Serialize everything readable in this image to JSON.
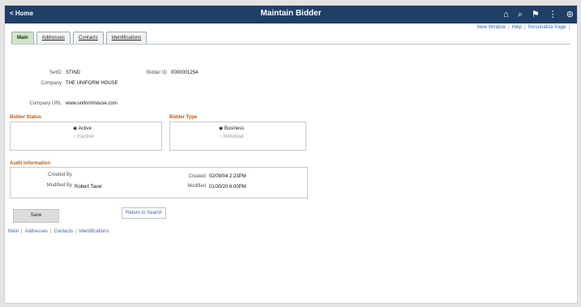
{
  "header": {
    "home": "< Home",
    "title": "Maintain Bidder",
    "icons": {
      "home": "⌂",
      "search": "⌕",
      "flag": "⚑",
      "menu": "⋮",
      "nav": "⊚"
    }
  },
  "toplinks": [
    "New Window",
    "Help",
    "Personalize Page"
  ],
  "tabs": [
    "Main",
    "Addresses",
    "Contacts",
    "Identifications"
  ],
  "fields": {
    "setid_label": "SetID",
    "setid_value": "STIND",
    "bidder_label": "Bidder ID",
    "bidder_value": "0000001254",
    "company_label": "Company",
    "company_value": "THE UNIFORM HOUSE",
    "url_label": "Company URL",
    "url_value": "www.uniformhouse.com"
  },
  "bidder_status": {
    "title": "Bidder Status",
    "options": [
      "Active",
      "Inactive"
    ],
    "selected": "Active"
  },
  "bidder_type": {
    "title": "Bidder Type",
    "options": [
      "Business",
      "Individual"
    ],
    "selected": "Business"
  },
  "audit": {
    "title": "Audit Information",
    "created_by_label": "Created By",
    "created_by_value": "",
    "modified_by_label": "Modified By",
    "modified_by_value": "Robert Tavel",
    "created_label": "Created",
    "created_value": "02/09/04  2:23PM",
    "modified_label": "Modified",
    "modified_value": "01/30/20  6:00PM"
  },
  "buttons": {
    "save": "Save",
    "return": "Return to Search"
  },
  "bottom_nav": [
    "Main",
    "Addresses",
    "Contacts",
    "Identifications"
  ],
  "colors": {
    "header": "#1f3f66",
    "section_title": "#b85c14",
    "link": "#3a66b0",
    "active_tab": "#cfe6c4"
  }
}
